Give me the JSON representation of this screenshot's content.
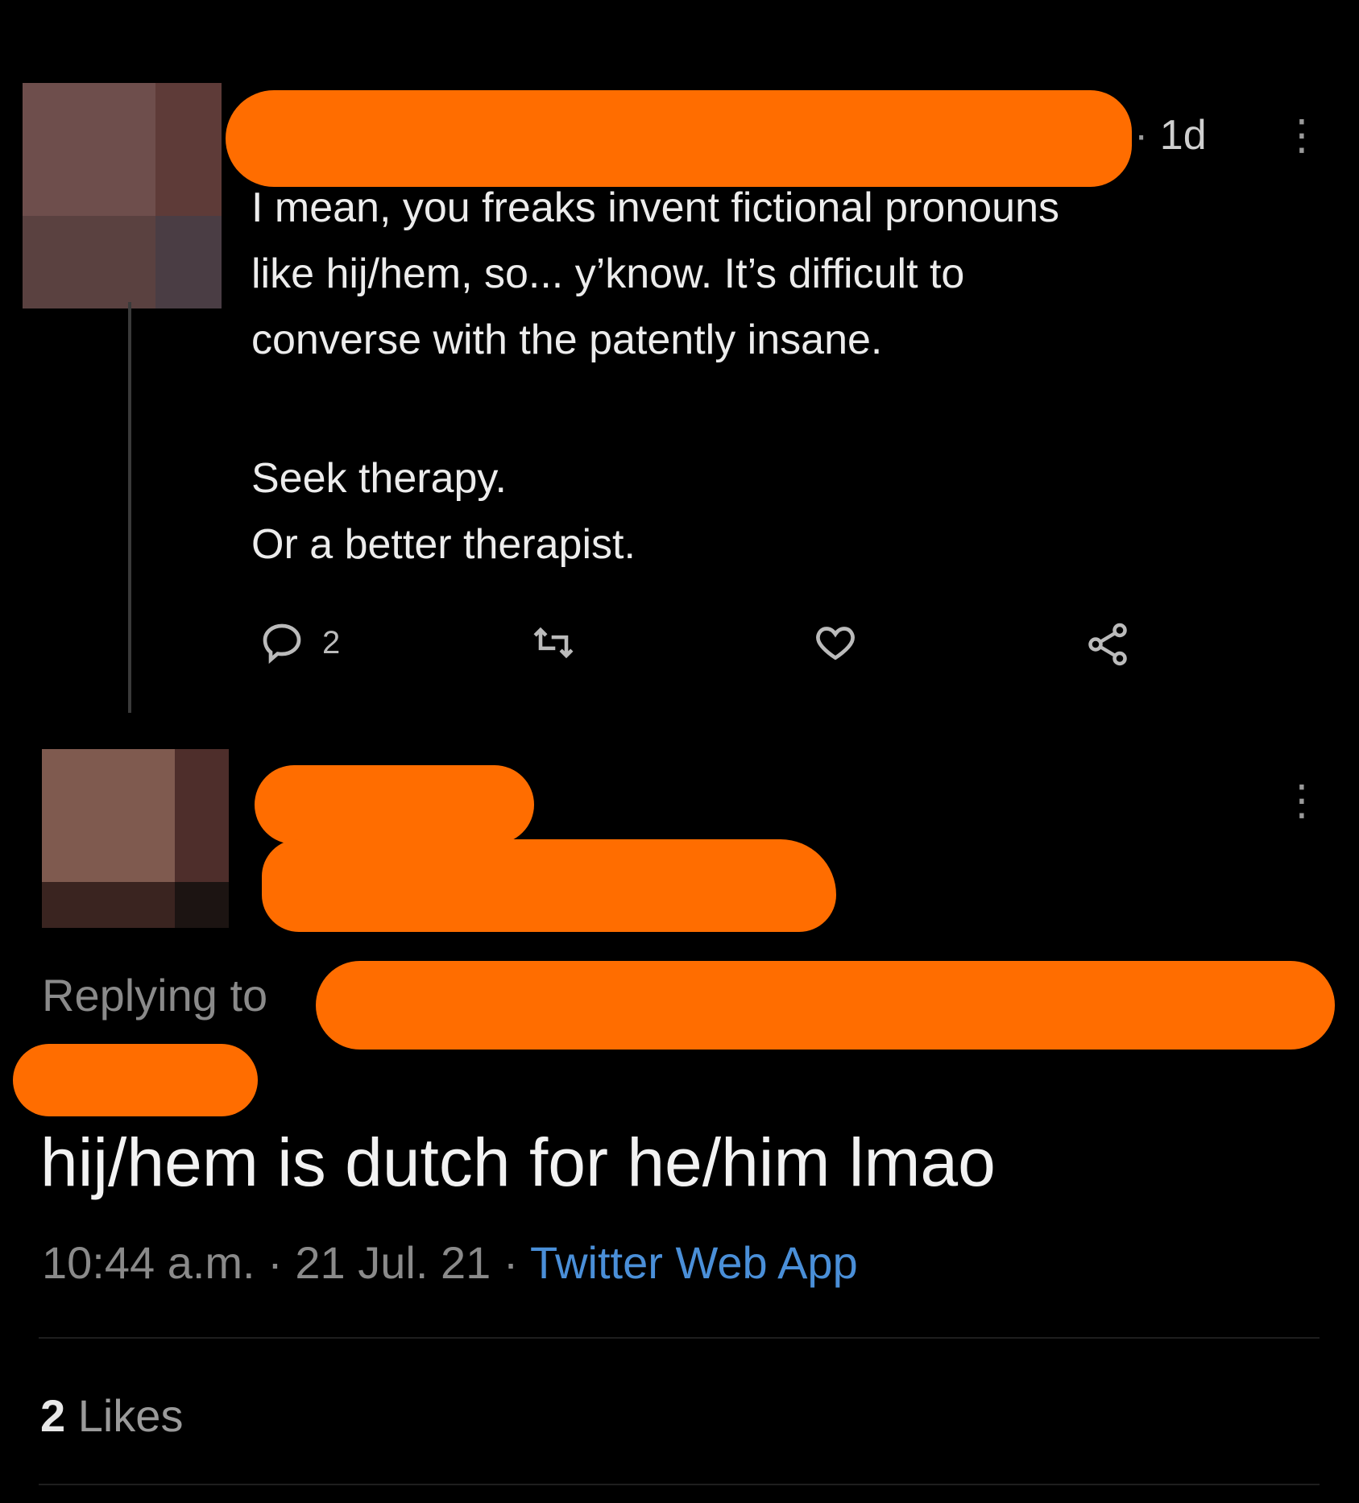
{
  "quoted_tweet": {
    "age": "1d",
    "more_icon": "vertical-ellipsis-icon",
    "paragraph_lines": [
      "I mean, you freaks invent fictional pronouns",
      "like hij/hem, so... y’know. It’s difficult to",
      "converse with the patently insane."
    ],
    "closing_lines": [
      "Seek therapy.",
      "Or a better therapist."
    ],
    "actions": {
      "reply_icon": "comment-icon",
      "reply_count": "2",
      "retweet_icon": "retweet-icon",
      "like_icon": "heart-icon",
      "share_icon": "share-icon"
    }
  },
  "main_tweet": {
    "more_icon": "vertical-ellipsis-icon",
    "replying_to_label": "Replying to",
    "text": "hij/hem is dutch for he/him lmao",
    "time": "10:44 a.m.",
    "date": "21 Jul. 21",
    "source": "Twitter Web App",
    "likes_count": "2",
    "likes_label": "Likes"
  },
  "colors": {
    "background": "#000000",
    "redaction": "#ff6d00",
    "link": "#4a8fd8",
    "muted_text": "#8a8a8a"
  }
}
